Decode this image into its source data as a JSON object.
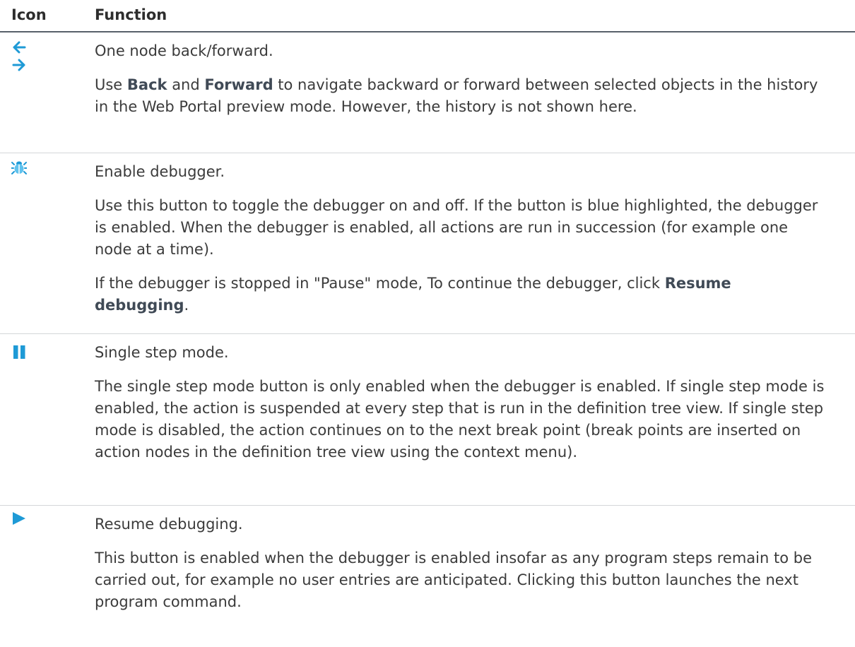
{
  "table": {
    "header": {
      "icon": "Icon",
      "function": "Function"
    },
    "rows": [
      {
        "icons": [
          "arrow-left-icon",
          "arrow-right-icon"
        ],
        "title": "One node back/forward.",
        "desc_parts": {
          "p1": "Use ",
          "b1": "Back",
          "p2": " and ",
          "b2": "Forward",
          "p3": " to navigate backward or forward between selected objects in the history in the Web Portal preview mode. However, the history is not shown here."
        }
      },
      {
        "icons": [
          "bug-icon"
        ],
        "title": "Enable debugger.",
        "desc": "Use this button to toggle the debugger on and off. If the button is blue highlighted, the debugger is enabled. When the debugger is enabled, all actions are run in succession (for example one node at a time).",
        "desc2_parts": {
          "p1": "If the debugger is stopped in \"Pause\" mode, To continue the debugger, click ",
          "b1": "Resume debugging",
          "p2": "."
        }
      },
      {
        "icons": [
          "pause-icon"
        ],
        "title": "Single step mode.",
        "desc": "The single step mode button is only enabled when the debugger is enabled. If single step mode is enabled, the action is suspended at every step that is run in the definition tree view. If single step mode is disabled, the action continues on to the next break point (break points are inserted on action nodes in the definition tree view using the context menu)."
      },
      {
        "icons": [
          "play-icon"
        ],
        "title": "Resume debugging.",
        "desc": "This button is enabled when the debugger is enabled insofar as any program steps remain to be carried out, for example no user entries are anticipated. Clicking this button launches the next program command."
      }
    ]
  },
  "colors": {
    "icon_blue": "#1e9ad6",
    "header_rule": "#58606a",
    "row_rule": "#d4d6d9"
  }
}
